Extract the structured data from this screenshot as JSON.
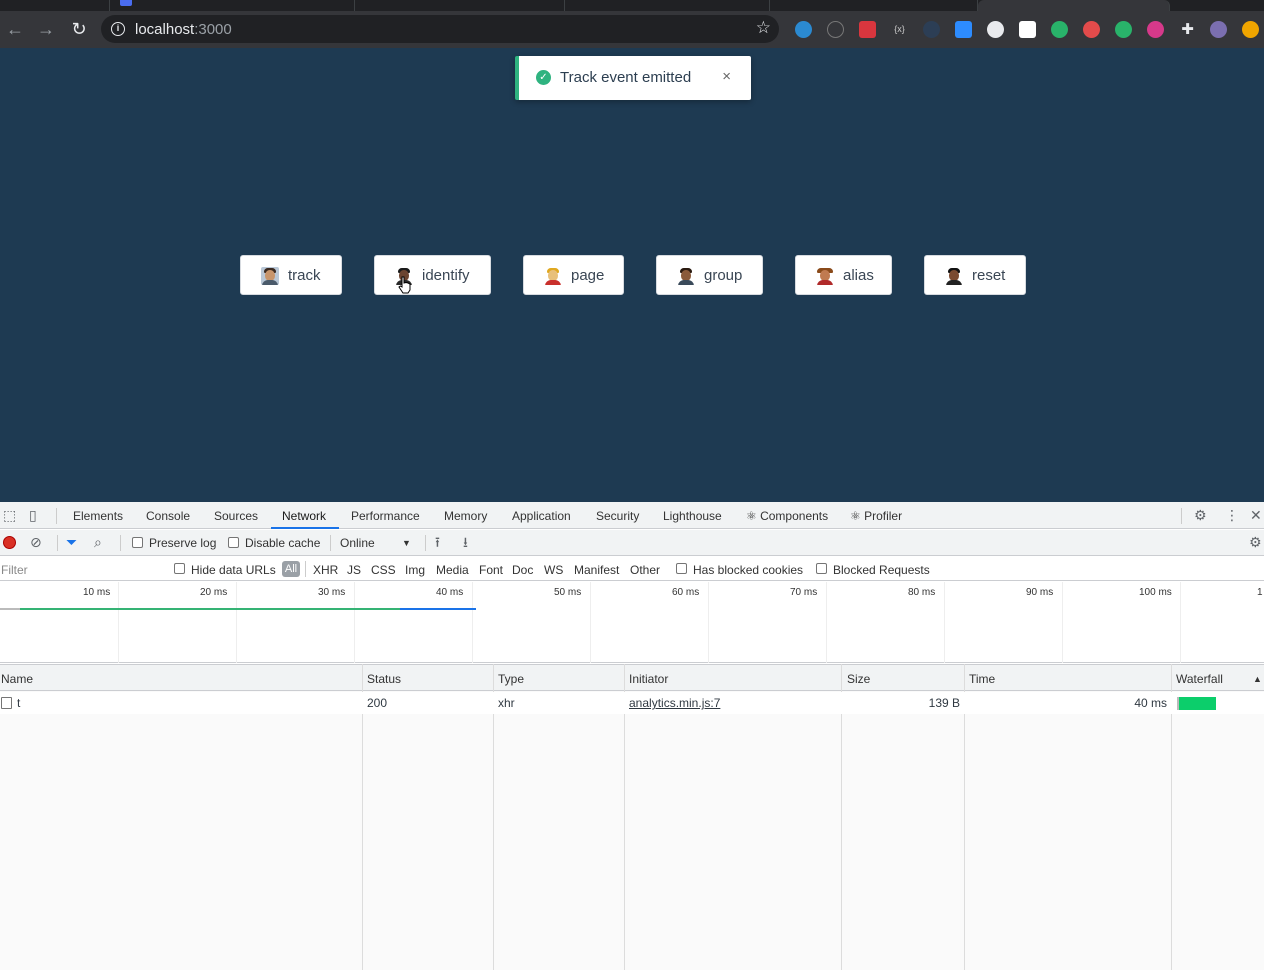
{
  "browser": {
    "url_host": "localhost",
    "url_port": ":3000",
    "colors": {
      "chrome_bg": "#35363a",
      "omnibox_bg": "#202124"
    }
  },
  "toast": {
    "message": "Track event emitted",
    "close_glyph": "×",
    "accent_color": "#2fb380"
  },
  "actions": [
    {
      "label": "track",
      "icon": "avatar-man-light"
    },
    {
      "label": "identify",
      "icon": "avatar-man-dark"
    },
    {
      "label": "page",
      "icon": "avatar-crown"
    },
    {
      "label": "group",
      "icon": "avatar-person"
    },
    {
      "label": "alias",
      "icon": "avatar-cowboy"
    },
    {
      "label": "reset",
      "icon": "avatar-man-beard"
    }
  ],
  "devtools": {
    "tabs": [
      "Elements",
      "Console",
      "Sources",
      "Network",
      "Performance",
      "Memory",
      "Application",
      "Security",
      "Lighthouse",
      "⚛ Components",
      "⚛ Profiler"
    ],
    "active_tab": "Network",
    "toolbar": {
      "preserve_log": "Preserve log",
      "disable_cache": "Disable cache",
      "throttle": "Online"
    },
    "filter": {
      "placeholder": "Filter",
      "hide_data_urls": "Hide data URLs",
      "all": "All",
      "types": [
        "XHR",
        "JS",
        "CSS",
        "Img",
        "Media",
        "Font",
        "Doc",
        "WS",
        "Manifest",
        "Other"
      ],
      "has_blocked_cookies": "Has blocked cookies",
      "blocked_requests": "Blocked Requests"
    },
    "timeline_ticks": [
      "10 ms",
      "20 ms",
      "30 ms",
      "40 ms",
      "50 ms",
      "60 ms",
      "70 ms",
      "80 ms",
      "90 ms",
      "100 ms",
      "1"
    ],
    "columns": [
      "Name",
      "Status",
      "Type",
      "Initiator",
      "Size",
      "Time",
      "Waterfall"
    ],
    "requests": [
      {
        "name": "t",
        "status": "200",
        "type": "xhr",
        "initiator": "analytics.min.js:7",
        "size": "139 B",
        "time": "40 ms"
      }
    ]
  }
}
